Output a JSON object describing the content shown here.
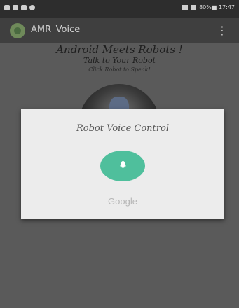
{
  "status_bar": {
    "right_text": "80%■ 17:47"
  },
  "app_bar": {
    "title": "AMR_Voice",
    "menu_glyph": "⋮"
  },
  "content": {
    "heading": "Android Meets Robots !",
    "subheading": "Talk to Your Robot",
    "hint": "Click Robot to Speak!"
  },
  "dialog": {
    "title": "Robot Voice Control",
    "mic_icon": "microphone-icon",
    "brand": "Google"
  },
  "colors": {
    "accent": "#4fbf9c",
    "dim_overlay": "#5a5a5a",
    "dialog_bg": "#ececec"
  }
}
